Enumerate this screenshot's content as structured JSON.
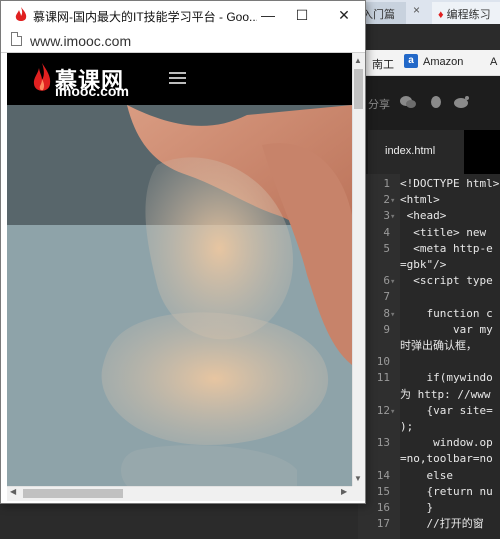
{
  "foreground_window": {
    "title": "慕课网-国内最大的IT技能学习平台 - Goo...",
    "url": "www.imooc.com",
    "buttons": {
      "minimize": "—",
      "maximize": "☐",
      "close": "✕"
    }
  },
  "site": {
    "logo_main": "慕课网",
    "logo_sub": "imooc.com"
  },
  "background_browser": {
    "tabs": [
      "入门篇",
      "编程练习"
    ],
    "tab_close": "×",
    "bookmarks": [
      "南工",
      "Amazon",
      "A"
    ],
    "share_label": "分享",
    "amazon_icon": "a"
  },
  "editor": {
    "file_tab": "index.html",
    "lines": [
      {
        "n": "1",
        "fold": "",
        "text": "<!DOCTYPE html>"
      },
      {
        "n": "2",
        "fold": "▾",
        "text": "<html>"
      },
      {
        "n": "3",
        "fold": "▾",
        "text": " <head>"
      },
      {
        "n": "4",
        "fold": "",
        "text": "  <title> new"
      },
      {
        "n": "5",
        "fold": "",
        "text": "  <meta http-e"
      },
      {
        "n": "",
        "fold": "",
        "text": "=gbk\"/>"
      },
      {
        "n": "6",
        "fold": "▾",
        "text": "  <script type"
      },
      {
        "n": "7",
        "fold": "",
        "text": ""
      },
      {
        "n": "8",
        "fold": "▾",
        "text": "    function c"
      },
      {
        "n": "9",
        "fold": "",
        "text": "        var my"
      },
      {
        "n": "",
        "fold": "",
        "text": "时弹出确认框，"
      },
      {
        "n": "10",
        "fold": "",
        "text": ""
      },
      {
        "n": "11",
        "fold": "",
        "text": "    if(mywindo"
      },
      {
        "n": "",
        "fold": "",
        "text": "为 http: //www"
      },
      {
        "n": "12",
        "fold": "▾",
        "text": "    {var site="
      },
      {
        "n": "",
        "fold": "",
        "text": ");"
      },
      {
        "n": "13",
        "fold": "",
        "text": "     window.op"
      },
      {
        "n": "",
        "fold": "",
        "text": "=no,toolbar=no"
      },
      {
        "n": "14",
        "fold": "",
        "text": "    else"
      },
      {
        "n": "15",
        "fold": "",
        "text": "    {return nu"
      },
      {
        "n": "16",
        "fold": "",
        "text": "    }"
      },
      {
        "n": "17",
        "fold": "",
        "text": "    //打开的窗"
      },
      {
        "n": "",
        "fold": "",
        "text": "。"
      },
      {
        "n": "18",
        "fold": "",
        "text": ""
      }
    ]
  }
}
